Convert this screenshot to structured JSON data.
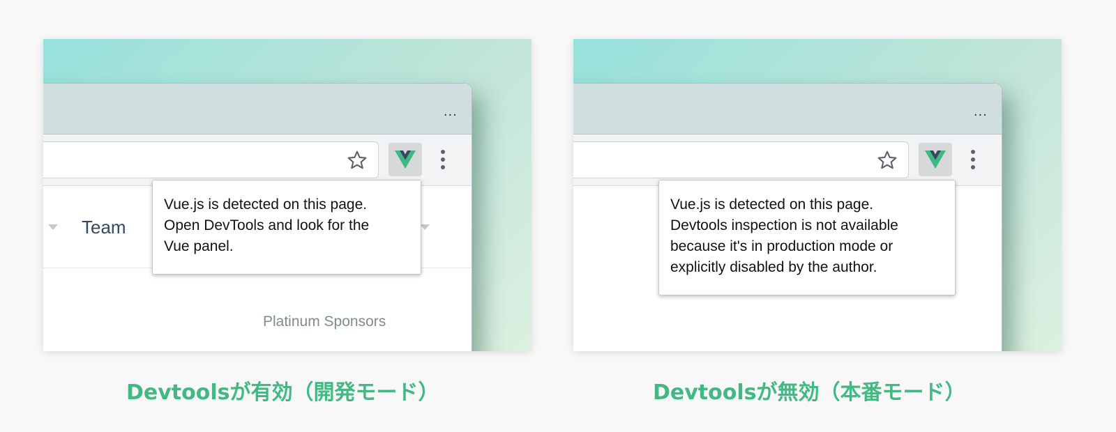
{
  "colors": {
    "accent": "#42b983",
    "vue_green": "#41b883",
    "vue_dark": "#35495e"
  },
  "left_panel": {
    "titlebar_menu": "...",
    "nav_item": "Team",
    "section_label": "Platinum Sponsors",
    "popup_text": "Vue.js is detected on this page.\nOpen DevTools and look for the\nVue panel.",
    "caption": "Devtoolsが有効（開発モード）"
  },
  "right_panel": {
    "titlebar_menu": "...",
    "popup_text": "Vue.js is detected on this page.\nDevtools inspection is not available\nbecause it's in production mode or\nexplicitly disabled by the author.",
    "caption": "Devtoolsが無効（本番モード）"
  },
  "icons": {
    "bookmark": "star-icon",
    "extension": "vue-logo-icon",
    "menu": "more-vert-icon"
  }
}
